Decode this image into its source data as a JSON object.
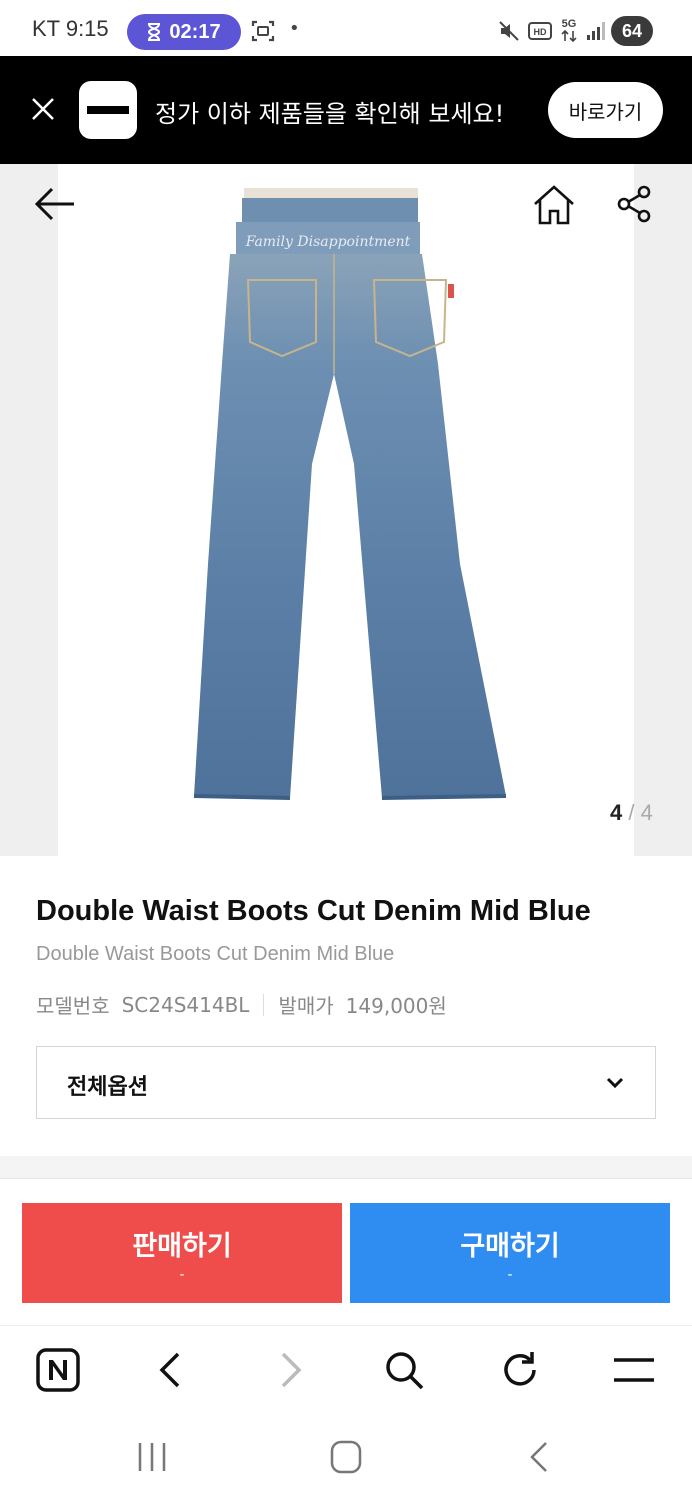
{
  "status_bar": {
    "carrier_time": "KT 9:15",
    "timer": "02:17",
    "dot": "•",
    "battery": "64"
  },
  "banner": {
    "text": "정가 이하 제품들을 확인해 보세요!",
    "button": "바로가기"
  },
  "gallery": {
    "current": "4",
    "separator": " / ",
    "total": "4"
  },
  "product": {
    "title": "Double Waist Boots Cut Denim Mid Blue",
    "subtitle": "Double Waist Boots Cut Denim Mid Blue",
    "model_label": "모델번호",
    "model_value": "SC24S414BL",
    "price_label": "발매가",
    "price_value": "149,000원"
  },
  "option": {
    "label": "전체옵션"
  },
  "actions": {
    "sell_label": "판매하기",
    "sell_sub": "-",
    "buy_label": "구매하기",
    "buy_sub": "-"
  },
  "colors": {
    "sell": "#ef4c4c",
    "buy": "#2f8cf0",
    "timer_pill": "#5c55d6",
    "denim": "#5b7fa6"
  },
  "icons": {
    "banner_close": "close-icon",
    "back": "arrow-left-icon",
    "home": "home-icon",
    "share": "share-icon",
    "option_chevron": "chevron-down-icon",
    "browser": [
      "naver-n-icon",
      "chevron-left-icon",
      "chevron-right-icon",
      "search-icon",
      "refresh-icon",
      "menu-icon"
    ],
    "nav": [
      "recent-apps-icon",
      "home-button-icon",
      "back-icon"
    ]
  }
}
